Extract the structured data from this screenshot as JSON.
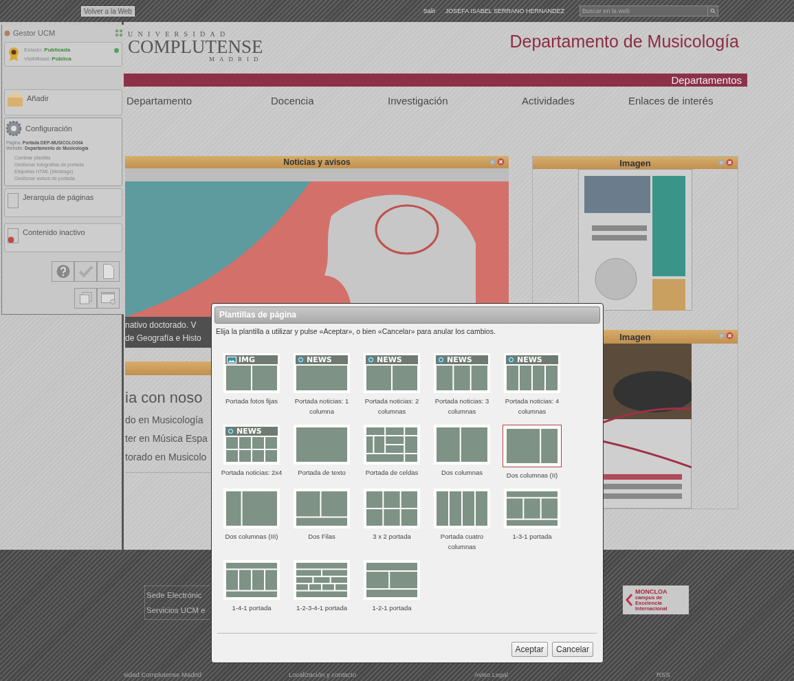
{
  "top_bar": {
    "back_link": "Volver a la Web",
    "logout": "Salir",
    "user": "JOSEFA ISABEL SERRANO HERNANDEZ",
    "search": {
      "placeholder": "Buscar en la web"
    }
  },
  "sidebar": {
    "title": "Gestor UCM",
    "state": "Estado: **Publicada**",
    "visibility": "Visibilidad: **Pública**",
    "add": "Añadir",
    "config": {
      "label": "Configuración",
      "page": "Página: **Portada DEP-MUSICOLOGIA**",
      "website": "Website: **Departamento de Musicología**",
      "links": [
        "Cambiar plantilla",
        "Gestionar fotografías de portada",
        "Etiquetas HTML (Metatags)",
        "Gestionar avisos de portada"
      ]
    },
    "hierarchy": "Jerarquía de páginas",
    "inactive": "Contenido inactivo"
  },
  "header": {
    "logo_top": "UNIVERSIDAD",
    "logo_main": "COMPLUTENSE",
    "logo_bottom": "MADRID",
    "title": "Departamento de Musicología",
    "section_bar": "Departamentos",
    "nav": [
      "Departamento",
      "Docencia",
      "Investigación",
      "Actividades",
      "Enlaces de interés"
    ]
  },
  "news_card": {
    "title": "Noticias y avisos",
    "caption": [
      "nativo doctorado. V",
      "de Geografía e Histo"
    ]
  },
  "study_card": {
    "heading": "ia con noso",
    "links": [
      "do en Musicología",
      "ter en Música Espa",
      "torado en Musicolo"
    ]
  },
  "image_cards": [
    {
      "title": "Imagen",
      "kind": "brochure"
    },
    {
      "title": "Imagen",
      "kind": "guitar"
    }
  ],
  "footer": {
    "links": [
      "Sede Electrónic",
      "Servicios UCM e"
    ],
    "campus_logo": [
      "MONCLOA",
      "campus de",
      "Excelencia",
      "Internacional"
    ],
    "bottom": [
      "sidad Complutense Madrid",
      "Localización y contacto",
      "Aviso Legal",
      "RSS"
    ]
  },
  "dialog": {
    "title": "Plantillas de página",
    "instruction": "Elija la plantilla a utilizar y pulse «Aceptar», o bien «Cancelar» para anular los cambios.",
    "templates": [
      {
        "label": "Portada fotos fijas",
        "kind": "two",
        "badge": {
          "kind": "image",
          "text": "IMG"
        },
        "selected": false
      },
      {
        "label": "Portada noticias: 1 columna",
        "kind": "one",
        "badge": {
          "kind": "news",
          "text": "NEWS"
        },
        "selected": false
      },
      {
        "label": "Portada noticias: 2 columnas",
        "kind": "two",
        "badge": {
          "kind": "news",
          "text": "NEWS"
        },
        "selected": false
      },
      {
        "label": "Portada noticias: 3 columnas",
        "kind": "three",
        "badge": {
          "kind": "news",
          "text": "NEWS"
        },
        "selected": false
      },
      {
        "label": "Portada noticias: 4 columnas",
        "kind": "four",
        "badge": {
          "kind": "news",
          "text": "NEWS"
        },
        "selected": false
      },
      {
        "label": "Portada noticias: 2x4",
        "kind": "grid2x4",
        "badge": {
          "kind": "news",
          "text": "NEWS"
        },
        "selected": false
      },
      {
        "label": "Portada de texto",
        "kind": "one",
        "selected": false
      },
      {
        "label": "Portada de celdas",
        "kind": "cells",
        "selected": false
      },
      {
        "label": "Dos columnas",
        "kind": "halves",
        "selected": false
      },
      {
        "label": "Dos columnas (II)",
        "kind": "wide_left",
        "selected": true
      },
      {
        "label": "Dos columnas (III)",
        "kind": "wide_right",
        "selected": false
      },
      {
        "label": "Dos Filas",
        "kind": "rows",
        "selected": false
      },
      {
        "label": "3 x 2 portada",
        "kind": "grid3x2",
        "selected": false
      },
      {
        "label": "Portada cuatro columnas",
        "kind": "four",
        "selected": false
      },
      {
        "label": "1-3-1 portada",
        "kind": "l131",
        "selected": false
      },
      {
        "label": "1-4-1 portada",
        "kind": "l141",
        "selected": false
      },
      {
        "label": "1-2-3-4-1 portada",
        "kind": "l12341",
        "selected": false
      },
      {
        "label": "1-2-1 portada",
        "kind": "l121",
        "selected": false
      }
    ],
    "buttons": [
      "Aceptar",
      "Cancelar"
    ]
  }
}
